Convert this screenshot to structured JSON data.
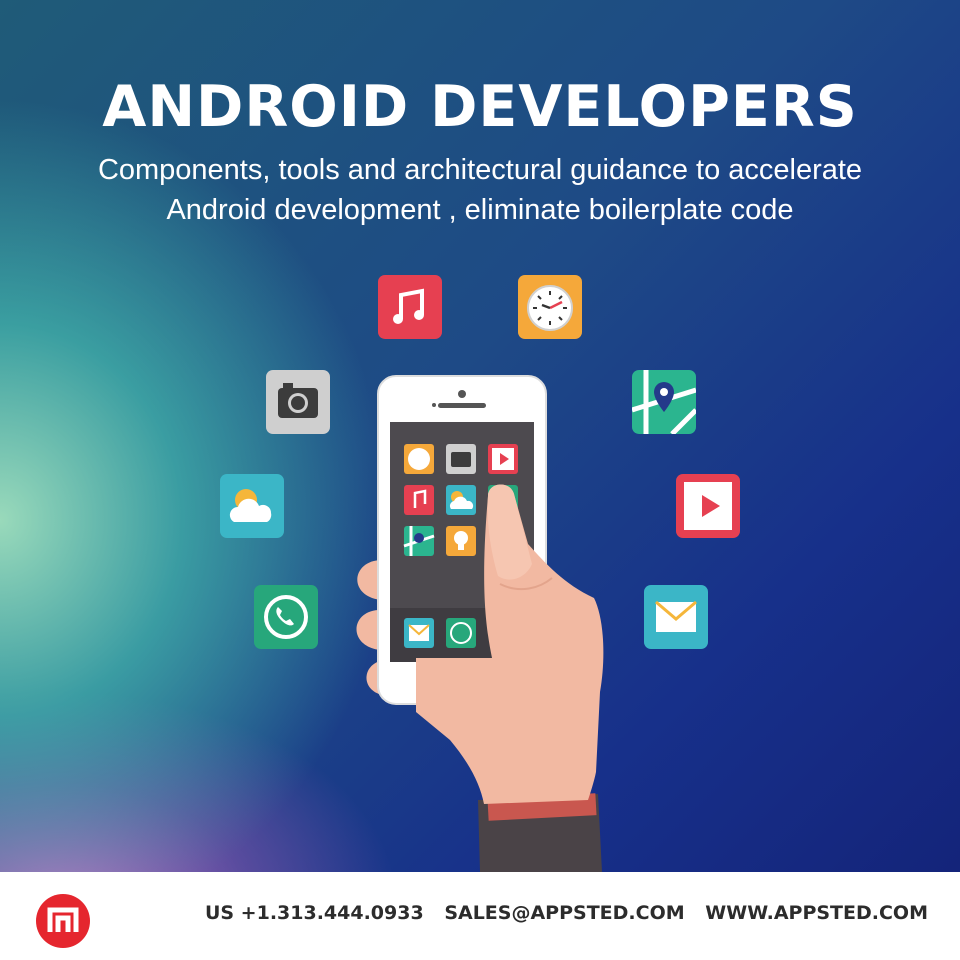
{
  "hero": {
    "title": "ANDROID DEVELOPERS",
    "subtitle_line1": "Components, tools and architectural guidance to accelerate",
    "subtitle_line2": "Android development , eliminate boilerplate code"
  },
  "icons": [
    "music-app-icon",
    "clock-app-icon",
    "camera-app-icon",
    "maps-app-icon",
    "weather-app-icon",
    "video-app-icon",
    "phone-app-icon",
    "mail-app-icon"
  ],
  "footer": {
    "phone": "US +1.313.444.0933",
    "email": "SALES@APPSTED.COM",
    "website": "WWW.APPSTED.COM"
  },
  "colors": {
    "accent_red": "#e64051",
    "clock_orange": "#f5a83a",
    "teal": "#2bb5a9",
    "phone_green": "#27a77b",
    "logo_red": "#e5262e"
  }
}
